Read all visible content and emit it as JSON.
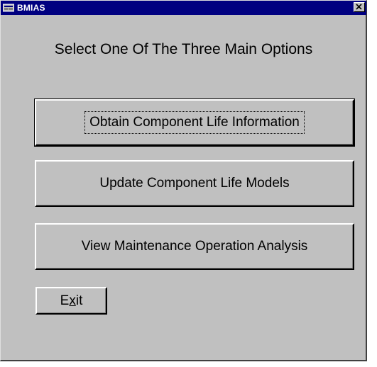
{
  "window": {
    "title": "BMIAS",
    "icon": "app-icon",
    "close_icon": "close-icon"
  },
  "heading": "Select One Of The Three Main Options",
  "buttons": {
    "obtain": "Obtain Component Life Information",
    "update": "Update Component Life Models",
    "view": "View Maintenance Operation Analysis",
    "exit_prefix": "E",
    "exit_accel": "x",
    "exit_suffix": "it"
  },
  "colors": {
    "titlebar": "#000080",
    "face": "#c0c0c0"
  }
}
